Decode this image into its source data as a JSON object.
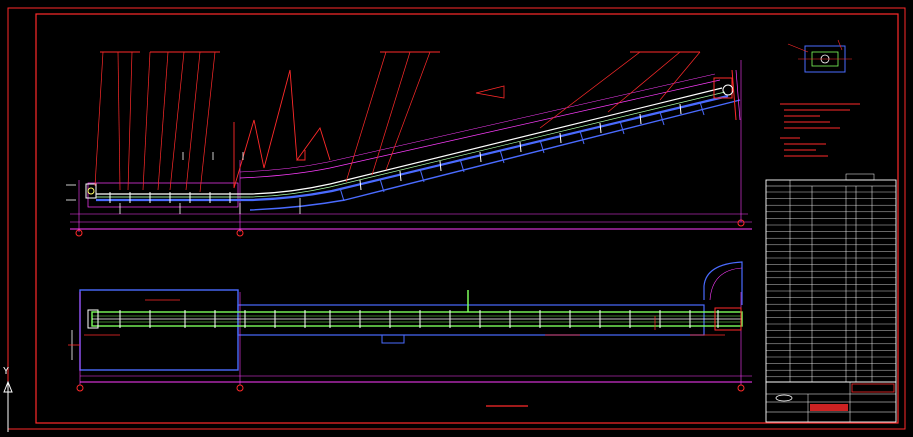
{
  "drawing": {
    "axis_label": "Y",
    "elevation_label": "",
    "plan_label": "",
    "title_block": {
      "company": "",
      "drawing_no": "",
      "drawing_title": ""
    },
    "colors": {
      "background": "#000000",
      "frame": "#ff2a2a",
      "leader": "#ff2a2a",
      "dimension": "#ff3cff",
      "structure": "#4a6bff",
      "belt": "#ffffff",
      "belt_plan": "#7cff5a",
      "grid": "#ffffff",
      "note": "#ff2a2a"
    },
    "notes": [],
    "table_rows": []
  }
}
